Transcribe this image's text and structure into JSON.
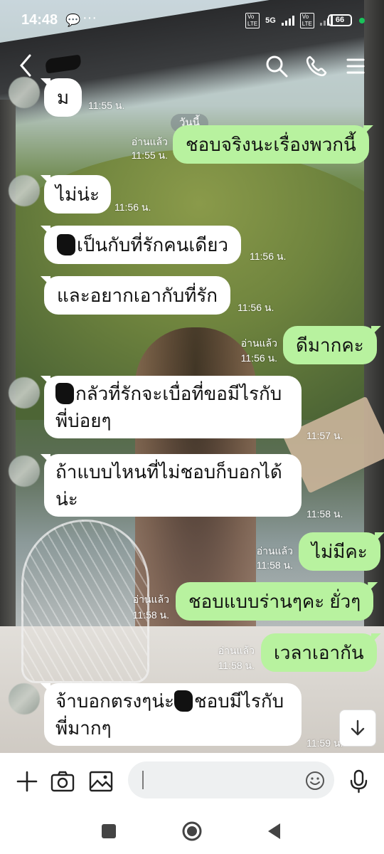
{
  "status_bar": {
    "time": "14:48",
    "network_1": "5G",
    "volte": "Vo LTE",
    "battery": "66"
  },
  "header": {
    "contact_name": ""
  },
  "date_chip": "วันนี้",
  "messages": [
    {
      "side": "in",
      "text": "ม",
      "time": "11:55 น.",
      "read": ""
    },
    {
      "side": "out",
      "text": "ชอบจริงนะเรื่องพวกนี้",
      "time": "11:55 น.",
      "read": "อ่านแล้ว"
    },
    {
      "side": "in",
      "text": "ไม่น่ะ",
      "time": "11:56 น.",
      "read": ""
    },
    {
      "side": "in",
      "text": "เป็นกับที่รักคนเดียว",
      "time": "11:56 น.",
      "read": ""
    },
    {
      "side": "in",
      "text": "และอยากเอากับที่รัก",
      "time": "11:56 น.",
      "read": ""
    },
    {
      "side": "out",
      "text": "ดีมากคะ",
      "time": "11:56 น.",
      "read": "อ่านแล้ว"
    },
    {
      "side": "in",
      "text_line1": "กลัวที่รักจะเบื่อที่ขอมีไรกับ",
      "text_line2": "พี่บ่อยๆ",
      "time": "11:57 น.",
      "read": ""
    },
    {
      "side": "in",
      "text_line1": "ถ้าแบบไหนที่ไม่ชอบก็บอกได้",
      "text_line2": "น่ะ",
      "time": "11:58 น.",
      "read": ""
    },
    {
      "side": "out",
      "text": "ไม่มีคะ",
      "time": "11:58 น.",
      "read": "อ่านแล้ว"
    },
    {
      "side": "out",
      "text": "ชอบแบบร่านๆคะ ยั่วๆ",
      "time": "11:58 น.",
      "read": "อ่านแล้ว"
    },
    {
      "side": "out",
      "text": "เวลาเอากัน",
      "time": "11:58 น.",
      "read": "อ่านแล้ว"
    },
    {
      "side": "in",
      "text_line1a": "จ้าบอกตรงๆน่ะ",
      "text_line1b": "ชอบมีไรกับ",
      "text_line2": "พี่มากๆ",
      "time": "11:59 น.",
      "read": ""
    }
  ],
  "input": {
    "placeholder": ""
  },
  "colors": {
    "outgoing_bubble": "#b8f29f",
    "incoming_bubble": "#ffffff",
    "online_dot": "#19c35a"
  },
  "icons": [
    "back-icon",
    "search-icon",
    "phone-icon",
    "menu-icon",
    "plus-icon",
    "camera-icon",
    "image-icon",
    "emoji-icon",
    "mic-icon",
    "scroll-down-icon",
    "nav-recents-icon",
    "nav-home-icon",
    "nav-back-icon"
  ]
}
